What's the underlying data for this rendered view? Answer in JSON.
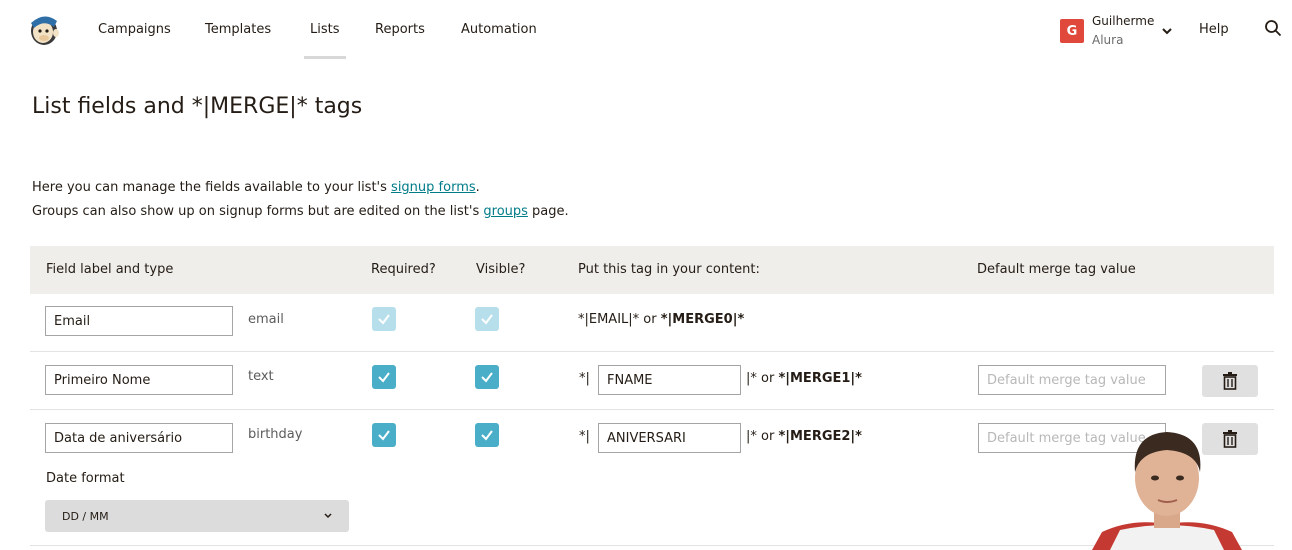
{
  "nav": {
    "items": [
      "Campaigns",
      "Templates",
      "Lists",
      "Reports",
      "Automation"
    ],
    "active": "Lists",
    "user_initial": "G",
    "user_name": "Guilherme",
    "user_org": "Alura",
    "help": "Help"
  },
  "page": {
    "title": "List fields and *|MERGE|* tags",
    "intro_line1_before": "Here you can manage the fields available to your list's ",
    "intro_line1_link": "signup forms",
    "intro_line1_after": ".",
    "intro_line2_before": "Groups can also show up on signup forms but are edited on the list's ",
    "intro_line2_link": "groups",
    "intro_line2_after": " page."
  },
  "table": {
    "headers": {
      "field": "Field label and type",
      "required": "Required?",
      "visible": "Visible?",
      "tag": "Put this tag in your content:",
      "default": "Default merge tag value"
    },
    "rows": [
      {
        "label": "Email",
        "type": "email",
        "tag_prefix": "*|EMAIL|* or ",
        "merge": "*|MERGE0|*"
      },
      {
        "label": "Primeiro Nome",
        "type": "text",
        "tag_open": "*|",
        "tag_value": "FNAME",
        "tag_close": "|* or ",
        "merge": "*|MERGE1|*",
        "default_placeholder": "Default merge tag value"
      },
      {
        "label": "Data de aniversário",
        "type": "birthday",
        "tag_open": "*|",
        "tag_value": "ANIVERSARI",
        "tag_close": "|* or ",
        "merge": "*|MERGE2|*",
        "default_placeholder": "Default merge tag value",
        "date_format_label": "Date format",
        "date_format_value": "DD / MM"
      }
    ]
  },
  "colors": {
    "accent_link": "#007c89",
    "checkbox_on": "#4aaec8",
    "checkbox_disabled": "#b7dfeb",
    "avatar": "#e0483c"
  }
}
